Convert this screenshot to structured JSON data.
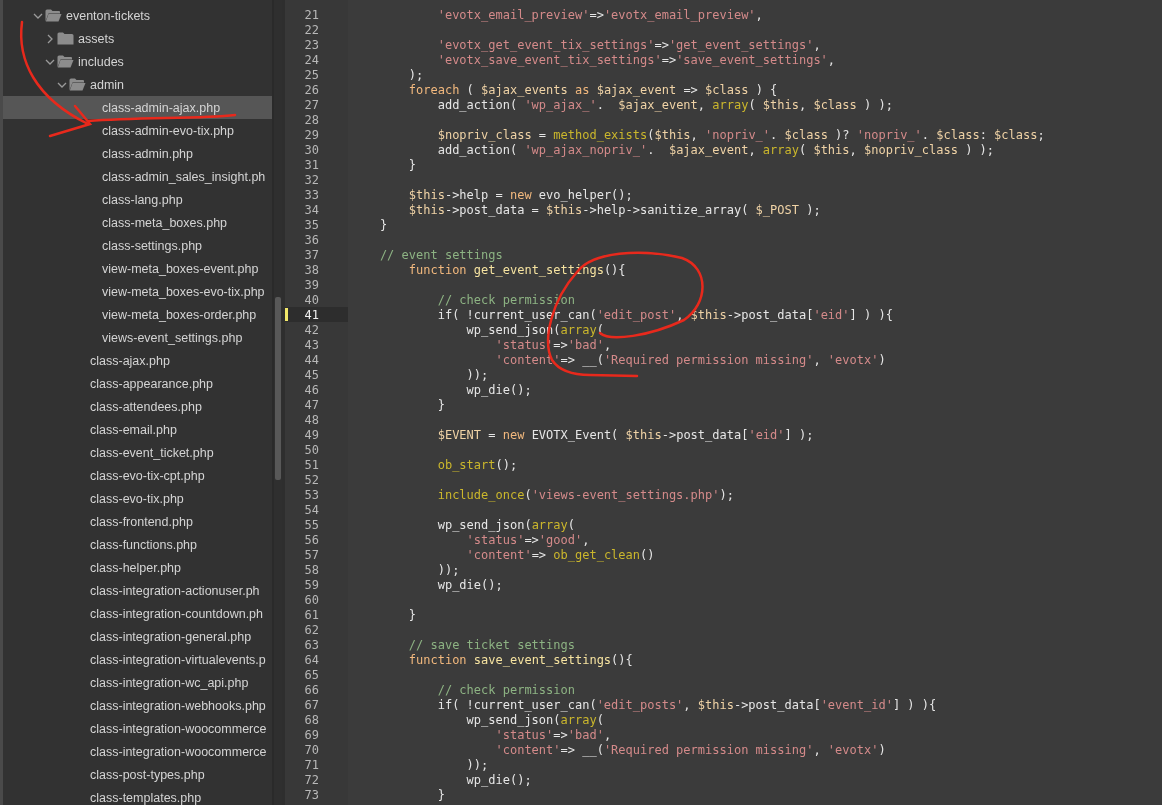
{
  "sidebar": {
    "tree": [
      {
        "kind": "folder",
        "label": "eventon-tickets",
        "expanded": true,
        "selected": false,
        "children": [
          {
            "kind": "folder",
            "label": "assets",
            "expanded": false,
            "selected": false
          },
          {
            "kind": "folder",
            "label": "includes",
            "expanded": true,
            "selected": false,
            "children": [
              {
                "kind": "folder",
                "label": "admin",
                "expanded": true,
                "selected": false,
                "children": [
                  {
                    "kind": "file",
                    "label": "class-admin-ajax.php",
                    "selected": true
                  },
                  {
                    "kind": "file",
                    "label": "class-admin-evo-tix.php",
                    "selected": false
                  },
                  {
                    "kind": "file",
                    "label": "class-admin.php",
                    "selected": false
                  },
                  {
                    "kind": "file",
                    "label": "class-admin_sales_insight.ph",
                    "selected": false
                  },
                  {
                    "kind": "file",
                    "label": "class-lang.php",
                    "selected": false
                  },
                  {
                    "kind": "file",
                    "label": "class-meta_boxes.php",
                    "selected": false
                  },
                  {
                    "kind": "file",
                    "label": "class-settings.php",
                    "selected": false
                  },
                  {
                    "kind": "file",
                    "label": "view-meta_boxes-event.php",
                    "selected": false
                  },
                  {
                    "kind": "file",
                    "label": "view-meta_boxes-evo-tix.php",
                    "selected": false
                  },
                  {
                    "kind": "file",
                    "label": "view-meta_boxes-order.php",
                    "selected": false
                  },
                  {
                    "kind": "file",
                    "label": "views-event_settings.php",
                    "selected": false
                  }
                ]
              },
              {
                "kind": "file",
                "label": "class-ajax.php",
                "selected": false
              },
              {
                "kind": "file",
                "label": "class-appearance.php",
                "selected": false
              },
              {
                "kind": "file",
                "label": "class-attendees.php",
                "selected": false
              },
              {
                "kind": "file",
                "label": "class-email.php",
                "selected": false
              },
              {
                "kind": "file",
                "label": "class-event_ticket.php",
                "selected": false
              },
              {
                "kind": "file",
                "label": "class-evo-tix-cpt.php",
                "selected": false
              },
              {
                "kind": "file",
                "label": "class-evo-tix.php",
                "selected": false
              },
              {
                "kind": "file",
                "label": "class-frontend.php",
                "selected": false
              },
              {
                "kind": "file",
                "label": "class-functions.php",
                "selected": false
              },
              {
                "kind": "file",
                "label": "class-helper.php",
                "selected": false
              },
              {
                "kind": "file",
                "label": "class-integration-actionuser.ph",
                "selected": false
              },
              {
                "kind": "file",
                "label": "class-integration-countdown.ph",
                "selected": false
              },
              {
                "kind": "file",
                "label": "class-integration-general.php",
                "selected": false
              },
              {
                "kind": "file",
                "label": "class-integration-virtualevents.p",
                "selected": false
              },
              {
                "kind": "file",
                "label": "class-integration-wc_api.php",
                "selected": false
              },
              {
                "kind": "file",
                "label": "class-integration-webhooks.php",
                "selected": false
              },
              {
                "kind": "file",
                "label": "class-integration-woocommerce",
                "selected": false
              },
              {
                "kind": "file",
                "label": "class-integration-woocommerce",
                "selected": false
              },
              {
                "kind": "file",
                "label": "class-post-types.php",
                "selected": false
              },
              {
                "kind": "file",
                "label": "class-templates.php",
                "selected": false
              }
            ]
          }
        ]
      }
    ]
  },
  "editor": {
    "lines": [
      {
        "number": "21",
        "current": false,
        "code": [
          {
            "kind": "string",
            "text": "            'evotx_email_preview'"
          },
          {
            "kind": "plain",
            "text": "=>"
          },
          {
            "kind": "string",
            "text": "'evotx_email_preview'"
          },
          {
            "kind": "plain",
            "text": ","
          }
        ]
      },
      {
        "number": "22",
        "current": false
      },
      {
        "number": "23",
        "current": false,
        "code": [
          {
            "kind": "string",
            "text": "            'evotx_get_event_tix_settings'"
          },
          {
            "kind": "plain",
            "text": "=>"
          },
          {
            "kind": "string",
            "text": "'get_event_settings'"
          },
          {
            "kind": "plain",
            "text": ","
          }
        ]
      },
      {
        "number": "24",
        "current": false,
        "code": [
          {
            "kind": "string",
            "text": "            'evotx_save_event_tix_settings'"
          },
          {
            "kind": "plain",
            "text": "=>"
          },
          {
            "kind": "string",
            "text": "'save_event_settings'"
          },
          {
            "kind": "plain",
            "text": ","
          }
        ]
      },
      {
        "number": "25",
        "current": false,
        "code": [
          {
            "kind": "plain",
            "text": "        );"
          }
        ]
      },
      {
        "number": "26",
        "current": false,
        "code": [
          {
            "kind": "keyword",
            "text": "        foreach"
          },
          {
            "kind": "plain",
            "text": " ( "
          },
          {
            "kind": "variable",
            "text": "$ajax_events"
          },
          {
            "kind": "keyword",
            "text": " as "
          },
          {
            "kind": "variable",
            "text": "$ajax_event"
          },
          {
            "kind": "plain",
            "text": " => "
          },
          {
            "kind": "variable",
            "text": "$class"
          },
          {
            "kind": "plain",
            "text": " ) {"
          }
        ]
      },
      {
        "number": "27",
        "current": false,
        "code": [
          {
            "kind": "plain",
            "text": "            add_action( "
          },
          {
            "kind": "string",
            "text": "'wp_ajax_'"
          },
          {
            "kind": "plain",
            "text": ".  "
          },
          {
            "kind": "variable",
            "text": "$ajax_event"
          },
          {
            "kind": "plain",
            "text": ", "
          },
          {
            "kind": "builtin",
            "text": "array"
          },
          {
            "kind": "plain",
            "text": "( "
          },
          {
            "kind": "variable",
            "text": "$this"
          },
          {
            "kind": "plain",
            "text": ", "
          },
          {
            "kind": "variable",
            "text": "$class"
          },
          {
            "kind": "plain",
            "text": " ) );"
          }
        ]
      },
      {
        "number": "28",
        "current": false
      },
      {
        "number": "29",
        "current": false,
        "code": [
          {
            "kind": "variable",
            "text": "            $nopriv_class"
          },
          {
            "kind": "plain",
            "text": " = "
          },
          {
            "kind": "builtin",
            "text": "method_exists"
          },
          {
            "kind": "plain",
            "text": "("
          },
          {
            "kind": "variable",
            "text": "$this"
          },
          {
            "kind": "plain",
            "text": ", "
          },
          {
            "kind": "string",
            "text": "'nopriv_'"
          },
          {
            "kind": "plain",
            "text": ". "
          },
          {
            "kind": "variable",
            "text": "$class"
          },
          {
            "kind": "plain",
            "text": " )? "
          },
          {
            "kind": "string",
            "text": "'nopriv_'"
          },
          {
            "kind": "plain",
            "text": ". "
          },
          {
            "kind": "variable",
            "text": "$class"
          },
          {
            "kind": "plain",
            "text": ": "
          },
          {
            "kind": "variable",
            "text": "$class"
          },
          {
            "kind": "plain",
            "text": ";"
          }
        ]
      },
      {
        "number": "30",
        "current": false,
        "code": [
          {
            "kind": "plain",
            "text": "            add_action( "
          },
          {
            "kind": "string",
            "text": "'wp_ajax_nopriv_'"
          },
          {
            "kind": "plain",
            "text": ".  "
          },
          {
            "kind": "variable",
            "text": "$ajax_event"
          },
          {
            "kind": "plain",
            "text": ", "
          },
          {
            "kind": "builtin",
            "text": "array"
          },
          {
            "kind": "plain",
            "text": "( "
          },
          {
            "kind": "variable",
            "text": "$this"
          },
          {
            "kind": "plain",
            "text": ", "
          },
          {
            "kind": "variable",
            "text": "$nopriv_class"
          },
          {
            "kind": "plain",
            "text": " ) );"
          }
        ]
      },
      {
        "number": "31",
        "current": false,
        "code": [
          {
            "kind": "plain",
            "text": "        }"
          }
        ]
      },
      {
        "number": "32",
        "current": false
      },
      {
        "number": "33",
        "current": false,
        "code": [
          {
            "kind": "variable",
            "text": "        $this"
          },
          {
            "kind": "plain",
            "text": "->help = "
          },
          {
            "kind": "keyword",
            "text": "new"
          },
          {
            "kind": "plain",
            "text": " evo_helper();"
          }
        ]
      },
      {
        "number": "34",
        "current": false,
        "code": [
          {
            "kind": "variable",
            "text": "        $this"
          },
          {
            "kind": "plain",
            "text": "->post_data = "
          },
          {
            "kind": "variable",
            "text": "$this"
          },
          {
            "kind": "plain",
            "text": "->help->sanitize_array( "
          },
          {
            "kind": "variable",
            "text": "$_POST"
          },
          {
            "kind": "plain",
            "text": " );"
          }
        ]
      },
      {
        "number": "35",
        "current": false,
        "code": [
          {
            "kind": "plain",
            "text": "    }"
          }
        ]
      },
      {
        "number": "36",
        "current": false
      },
      {
        "number": "37",
        "current": false,
        "code": [
          {
            "kind": "comment",
            "text": "    // event settings"
          }
        ]
      },
      {
        "number": "38",
        "current": false,
        "code": [
          {
            "kind": "keyword",
            "text": "        function "
          },
          {
            "kind": "definition",
            "text": "get_event_settings"
          },
          {
            "kind": "plain",
            "text": "(){"
          }
        ]
      },
      {
        "number": "39",
        "current": false
      },
      {
        "number": "40",
        "current": false,
        "code": [
          {
            "kind": "comment",
            "text": "            // check permission"
          }
        ]
      },
      {
        "number": "41",
        "current": true,
        "code": [
          {
            "kind": "plain",
            "text": "            if( !current_user_can("
          },
          {
            "kind": "string",
            "text": "'edit_post'"
          },
          {
            "kind": "plain",
            "text": ", "
          },
          {
            "kind": "variable",
            "text": "$this"
          },
          {
            "kind": "plain",
            "text": "->post_data["
          },
          {
            "kind": "string",
            "text": "'eid'"
          },
          {
            "kind": "plain",
            "text": "] ) ){"
          }
        ]
      },
      {
        "number": "42",
        "current": false,
        "code": [
          {
            "kind": "plain",
            "text": "                wp_send_json("
          },
          {
            "kind": "builtin",
            "text": "array"
          },
          {
            "kind": "plain",
            "text": "("
          }
        ]
      },
      {
        "number": "43",
        "current": false,
        "code": [
          {
            "kind": "string",
            "text": "                    'status'"
          },
          {
            "kind": "plain",
            "text": "=>"
          },
          {
            "kind": "string",
            "text": "'bad'"
          },
          {
            "kind": "plain",
            "text": ","
          }
        ]
      },
      {
        "number": "44",
        "current": false,
        "code": [
          {
            "kind": "string",
            "text": "                    'content'"
          },
          {
            "kind": "plain",
            "text": "=> __("
          },
          {
            "kind": "string",
            "text": "'Required permission missing'"
          },
          {
            "kind": "plain",
            "text": ", "
          },
          {
            "kind": "string",
            "text": "'evotx'"
          },
          {
            "kind": "plain",
            "text": ")"
          }
        ]
      },
      {
        "number": "45",
        "current": false,
        "code": [
          {
            "kind": "plain",
            "text": "                ));"
          }
        ]
      },
      {
        "number": "46",
        "current": false,
        "code": [
          {
            "kind": "plain",
            "text": "                wp_die();"
          }
        ]
      },
      {
        "number": "47",
        "current": false,
        "code": [
          {
            "kind": "plain",
            "text": "            }"
          }
        ]
      },
      {
        "number": "48",
        "current": false
      },
      {
        "number": "49",
        "current": false,
        "code": [
          {
            "kind": "variable",
            "text": "            $EVENT"
          },
          {
            "kind": "plain",
            "text": " = "
          },
          {
            "kind": "keyword",
            "text": "new"
          },
          {
            "kind": "plain",
            "text": " EVOTX_Event( "
          },
          {
            "kind": "variable",
            "text": "$this"
          },
          {
            "kind": "plain",
            "text": "->post_data["
          },
          {
            "kind": "string",
            "text": "'eid'"
          },
          {
            "kind": "plain",
            "text": "] );"
          }
        ]
      },
      {
        "number": "50",
        "current": false
      },
      {
        "number": "51",
        "current": false,
        "code": [
          {
            "kind": "builtin",
            "text": "            ob_start"
          },
          {
            "kind": "plain",
            "text": "();"
          }
        ]
      },
      {
        "number": "52",
        "current": false
      },
      {
        "number": "53",
        "current": false,
        "code": [
          {
            "kind": "builtin",
            "text": "            include_once"
          },
          {
            "kind": "plain",
            "text": "("
          },
          {
            "kind": "string",
            "text": "'views-event_settings.php'"
          },
          {
            "kind": "plain",
            "text": ");"
          }
        ]
      },
      {
        "number": "54",
        "current": false
      },
      {
        "number": "55",
        "current": false,
        "code": [
          {
            "kind": "plain",
            "text": "            wp_send_json("
          },
          {
            "kind": "builtin",
            "text": "array"
          },
          {
            "kind": "plain",
            "text": "("
          }
        ]
      },
      {
        "number": "56",
        "current": false,
        "code": [
          {
            "kind": "string",
            "text": "                'status'"
          },
          {
            "kind": "plain",
            "text": "=>"
          },
          {
            "kind": "string",
            "text": "'good'"
          },
          {
            "kind": "plain",
            "text": ","
          }
        ]
      },
      {
        "number": "57",
        "current": false,
        "code": [
          {
            "kind": "string",
            "text": "                'content'"
          },
          {
            "kind": "plain",
            "text": "=> "
          },
          {
            "kind": "builtin",
            "text": "ob_get_clean"
          },
          {
            "kind": "plain",
            "text": "()"
          }
        ]
      },
      {
        "number": "58",
        "current": false,
        "code": [
          {
            "kind": "plain",
            "text": "            ));"
          }
        ]
      },
      {
        "number": "59",
        "current": false,
        "code": [
          {
            "kind": "plain",
            "text": "            wp_die();"
          }
        ]
      },
      {
        "number": "60",
        "current": false
      },
      {
        "number": "61",
        "current": false,
        "code": [
          {
            "kind": "plain",
            "text": "        }"
          }
        ]
      },
      {
        "number": "62",
        "current": false
      },
      {
        "number": "63",
        "current": false,
        "code": [
          {
            "kind": "comment",
            "text": "        // save ticket settings"
          }
        ]
      },
      {
        "number": "64",
        "current": false,
        "code": [
          {
            "kind": "keyword",
            "text": "        function "
          },
          {
            "kind": "definition",
            "text": "save_event_settings"
          },
          {
            "kind": "plain",
            "text": "(){"
          }
        ]
      },
      {
        "number": "65",
        "current": false
      },
      {
        "number": "66",
        "current": false,
        "code": [
          {
            "kind": "comment",
            "text": "            // check permission"
          }
        ]
      },
      {
        "number": "67",
        "current": false,
        "code": [
          {
            "kind": "plain",
            "text": "            if( !current_user_can("
          },
          {
            "kind": "string",
            "text": "'edit_posts'"
          },
          {
            "kind": "plain",
            "text": ", "
          },
          {
            "kind": "variable",
            "text": "$this"
          },
          {
            "kind": "plain",
            "text": "->post_data["
          },
          {
            "kind": "string",
            "text": "'event_id'"
          },
          {
            "kind": "plain",
            "text": "] ) ){"
          }
        ]
      },
      {
        "number": "68",
        "current": false,
        "code": [
          {
            "kind": "plain",
            "text": "                wp_send_json("
          },
          {
            "kind": "builtin",
            "text": "array"
          },
          {
            "kind": "plain",
            "text": "("
          }
        ]
      },
      {
        "number": "69",
        "current": false,
        "code": [
          {
            "kind": "string",
            "text": "                    'status'"
          },
          {
            "kind": "plain",
            "text": "=>"
          },
          {
            "kind": "string",
            "text": "'bad'"
          },
          {
            "kind": "plain",
            "text": ","
          }
        ]
      },
      {
        "number": "70",
        "current": false,
        "code": [
          {
            "kind": "string",
            "text": "                    'content'"
          },
          {
            "kind": "plain",
            "text": "=> __("
          },
          {
            "kind": "string",
            "text": "'Required permission missing'"
          },
          {
            "kind": "plain",
            "text": ", "
          },
          {
            "kind": "string",
            "text": "'evotx'"
          },
          {
            "kind": "plain",
            "text": ")"
          }
        ]
      },
      {
        "number": "71",
        "current": false,
        "code": [
          {
            "kind": "plain",
            "text": "                ));"
          }
        ]
      },
      {
        "number": "72",
        "current": false,
        "code": [
          {
            "kind": "plain",
            "text": "                wp_die();"
          }
        ]
      },
      {
        "number": "73",
        "current": false,
        "code": [
          {
            "kind": "plain",
            "text": "            }"
          }
        ]
      }
    ]
  }
}
